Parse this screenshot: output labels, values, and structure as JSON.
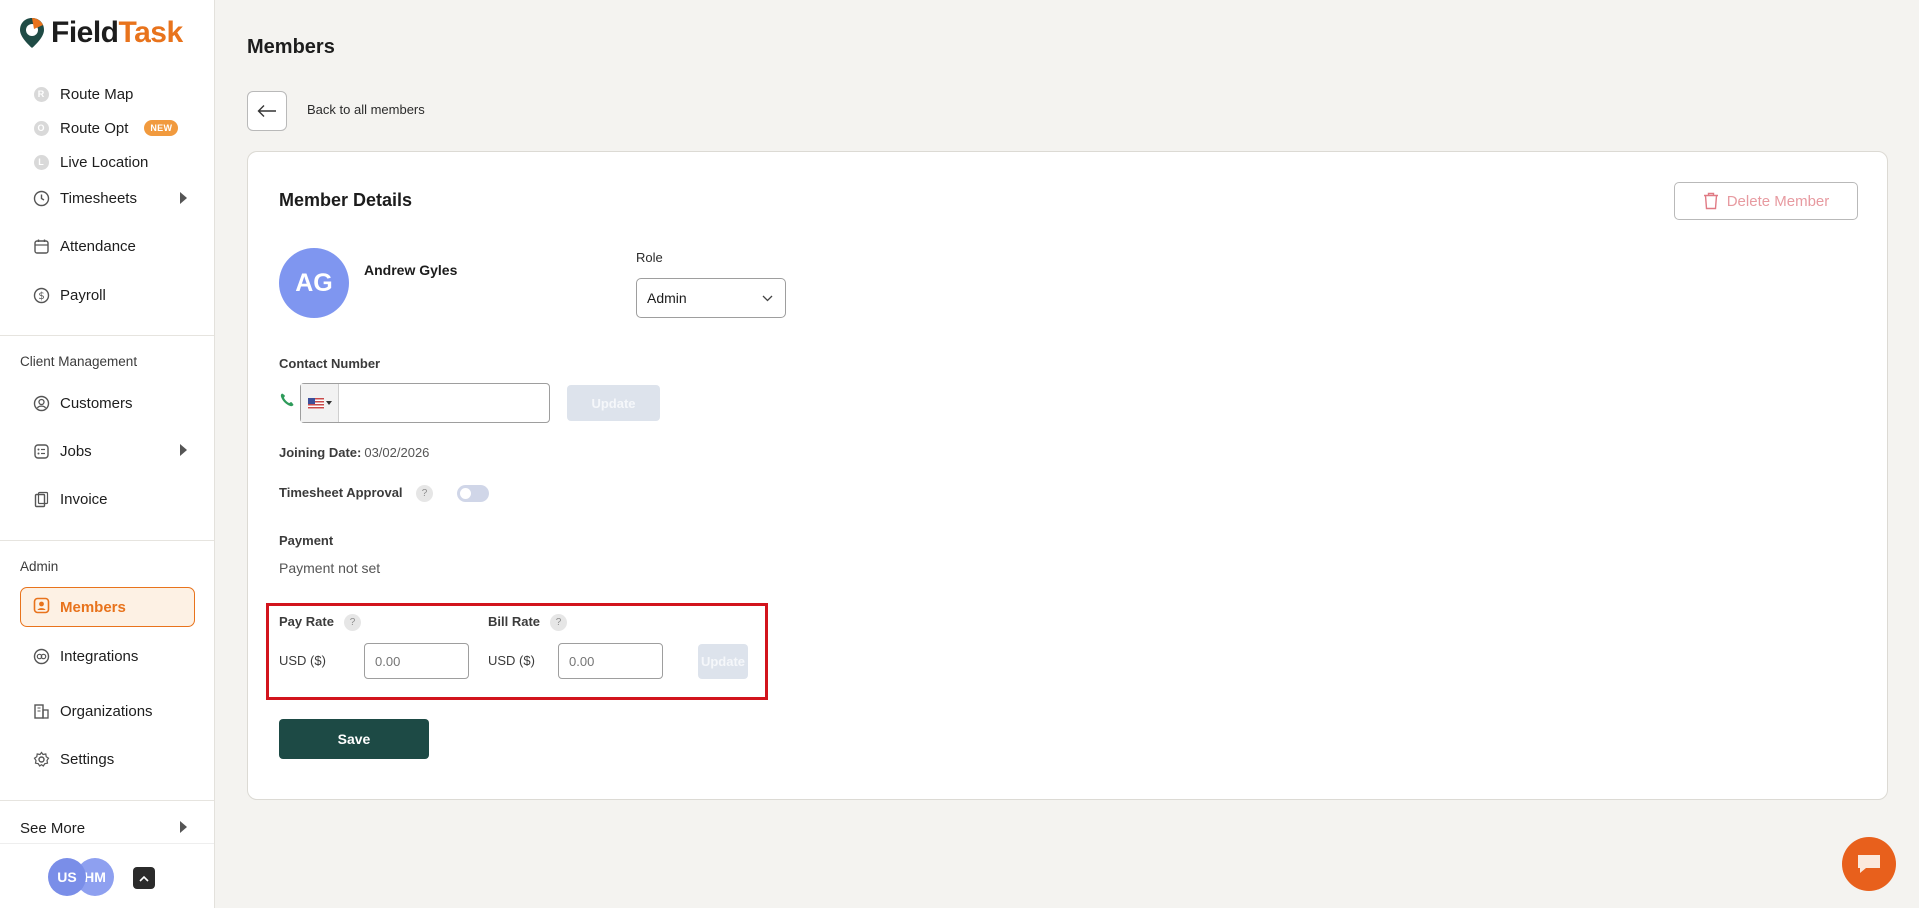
{
  "brand": {
    "part1": "Field",
    "part2": "Task"
  },
  "sidebar": {
    "items": [
      {
        "label": "Route Map",
        "icon": "R"
      },
      {
        "label": "Route Opt",
        "icon": "O",
        "badge": "NEW"
      },
      {
        "label": "Live Location",
        "icon": "L"
      },
      {
        "label": "Timesheets"
      },
      {
        "label": "Attendance"
      },
      {
        "label": "Payroll"
      }
    ],
    "client_section": "Client Management",
    "client_items": [
      {
        "label": "Customers"
      },
      {
        "label": "Jobs"
      },
      {
        "label": "Invoice"
      }
    ],
    "admin_section": "Admin",
    "admin_items": [
      {
        "label": "Members"
      },
      {
        "label": "Integrations"
      },
      {
        "label": "Organizations"
      },
      {
        "label": "Settings"
      }
    ],
    "see_more": "See More",
    "avatars": [
      "US",
      "HM"
    ]
  },
  "page": {
    "title": "Members",
    "back_label": "Back to all members"
  },
  "member": {
    "card_title": "Member Details",
    "delete_label": "Delete Member",
    "initials": "AG",
    "name": "Andrew Gyles",
    "role_label": "Role",
    "role_value": "Admin",
    "contact_label": "Contact Number",
    "phone_value": "",
    "update_label": "Update",
    "joining_label": "Joining Date:",
    "joining_value": "03/02/2026",
    "timesheet_label": "Timesheet Approval",
    "timesheet_enabled": false,
    "help_glyph": "?",
    "payment_label": "Payment",
    "payment_value": "Payment not set",
    "pay_rate_label": "Pay Rate",
    "bill_rate_label": "Bill Rate",
    "currency": "USD ($)",
    "rate_placeholder": "0.00",
    "save_label": "Save"
  },
  "colors": {
    "accent": "#e8731c",
    "primary": "#1d4a45",
    "highlight": "#d2141d",
    "avatar": "#7f96f0"
  }
}
